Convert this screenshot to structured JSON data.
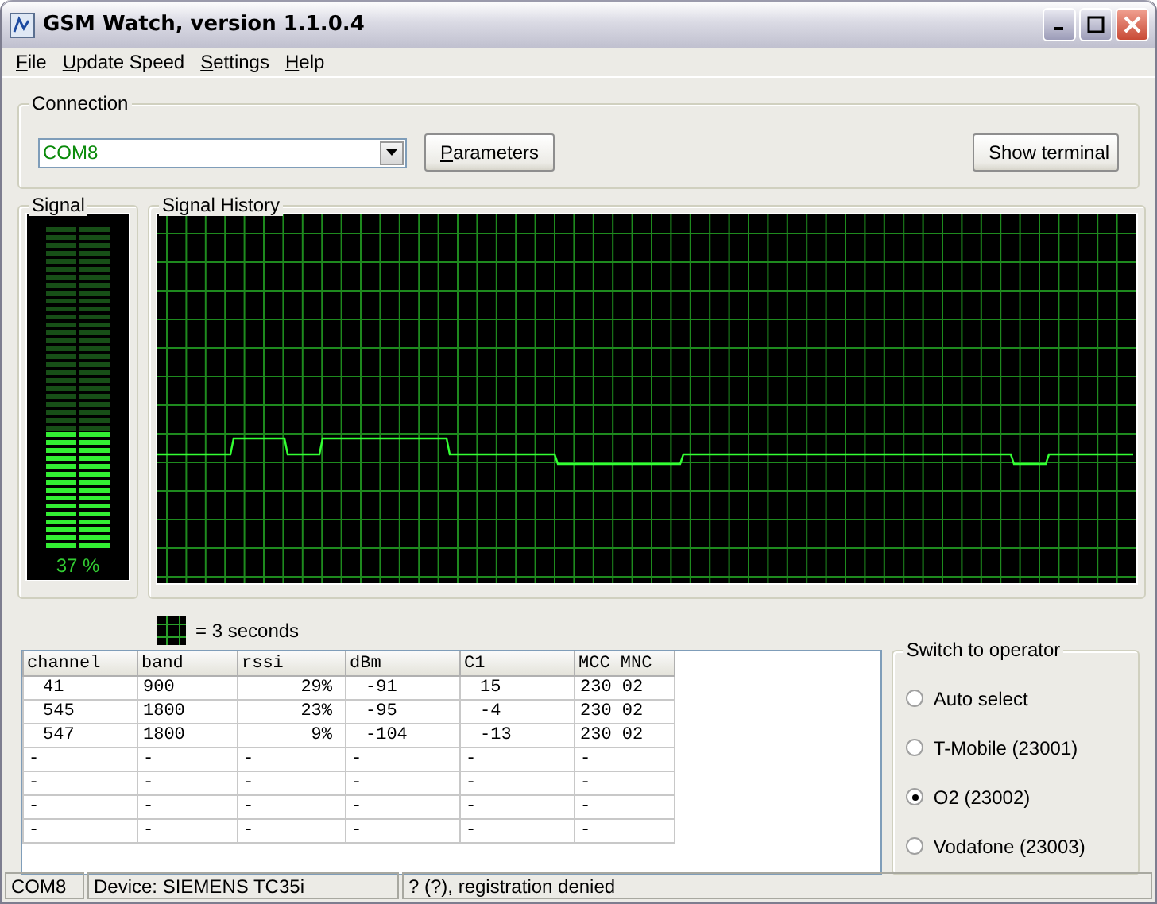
{
  "window": {
    "title": "GSM Watch, version 1.1.0.4"
  },
  "menu": [
    {
      "label": "File"
    },
    {
      "label": "Update Speed"
    },
    {
      "label": "Settings"
    },
    {
      "label": "Help"
    }
  ],
  "connection": {
    "label": "Connection",
    "port": "COM8",
    "parameters_button": "Parameters",
    "terminal_button": "Show terminal"
  },
  "signal": {
    "label": "Signal",
    "level": 0.37,
    "reading": "37 %"
  },
  "history": {
    "label": "Signal History",
    "legend": "= 3 seconds"
  },
  "cells": {
    "columns": [
      "channel",
      "band",
      "rssi",
      "dBm",
      "C1",
      "MCC MNC"
    ],
    "rows": [
      [
        "41",
        "900",
        "29%",
        "-91",
        "15",
        "230 02"
      ],
      [
        "545",
        "1800",
        "23%",
        "-95",
        "-4",
        "230 02"
      ],
      [
        "547",
        "1800",
        "9%",
        "-104",
        "-13",
        "230 02"
      ],
      [
        "-",
        "-",
        "-",
        "-",
        "-",
        "-"
      ],
      [
        "-",
        "-",
        "-",
        "-",
        "-",
        "-"
      ],
      [
        "-",
        "-",
        "-",
        "-",
        "-",
        "-"
      ],
      [
        "-",
        "-",
        "-",
        "-",
        "-",
        "-"
      ]
    ]
  },
  "operators": {
    "label": "Switch to operator",
    "options": [
      {
        "label": "Auto select",
        "selected": false
      },
      {
        "label": "T-Mobile (23001)",
        "selected": false
      },
      {
        "label": "O2 (23002)",
        "selected": true
      },
      {
        "label": "Vodafone (23003)",
        "selected": false
      }
    ]
  },
  "status_bar": [
    "COM8",
    "Device: SIEMENS TC35i",
    "? (?), registration denied"
  ]
}
